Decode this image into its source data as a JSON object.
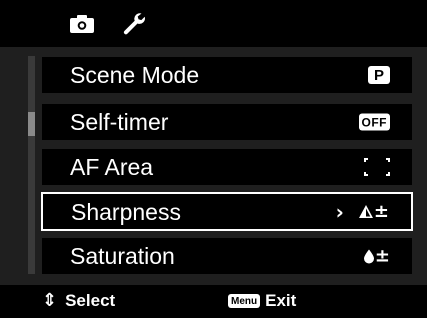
{
  "tabs": [
    {
      "name": "camera-tab",
      "icon": "camera-icon",
      "active": true
    },
    {
      "name": "setup-tab",
      "icon": "wrench-icon",
      "active": false
    }
  ],
  "menu": {
    "items": [
      {
        "label": "Scene Mode",
        "value": "P",
        "value_type": "badge-p"
      },
      {
        "label": "Self-timer",
        "value": "OFF",
        "value_type": "badge-off"
      },
      {
        "label": "AF Area",
        "value": "[ ]",
        "value_type": "af-area-icon"
      },
      {
        "label": "Sharpness",
        "value": "±",
        "value_type": "sharpness-icon",
        "selected": true
      },
      {
        "label": "Saturation",
        "value": "±",
        "value_type": "saturation-icon"
      }
    ],
    "scroll_position_fraction": 0.25
  },
  "footer": {
    "nav_label": "Select",
    "menu_key_label": "Menu",
    "menu_action_label": "Exit"
  },
  "colors": {
    "background": "#000000",
    "panel": "#1f1f1f",
    "text": "#ffffff"
  }
}
